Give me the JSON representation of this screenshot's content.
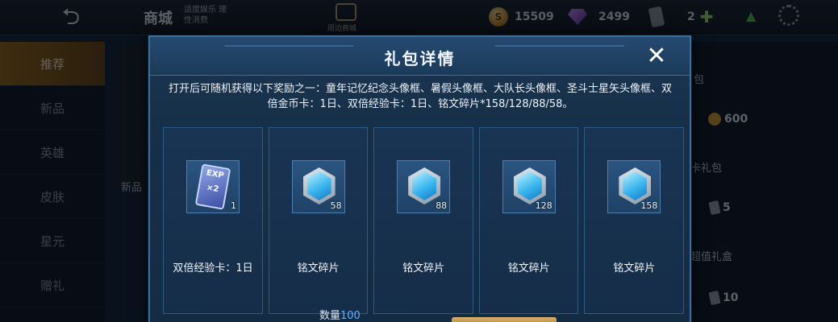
{
  "topbar": {
    "back_icon": "back-arrow-icon",
    "shop_title": "商城",
    "shop_note": "适度娱乐 理性消费",
    "mall_label": "周边商城",
    "gold": "15509",
    "diamond": "2499",
    "cards": "2"
  },
  "sidebar": {
    "items": [
      {
        "label": "推荐",
        "active": true
      },
      {
        "label": "新品"
      },
      {
        "label": "英雄"
      },
      {
        "label": "皮肤"
      },
      {
        "label": "星元"
      },
      {
        "label": "赠礼"
      }
    ]
  },
  "background": {
    "bg_text_1": "包",
    "price_1": "600",
    "bg_text_2": "卡礼包",
    "price_2": "5",
    "bg_text_3": "超值礼盒",
    "price_3": "10",
    "left_fragment": "新品"
  },
  "modal": {
    "title": "礼包详情",
    "close_label": "✕",
    "description": "打开后可随机获得以下奖励之一：童年记忆纪念头像框、暑假头像框、大队长头像框、圣斗士星矢头像框、双倍金币卡：1日、双倍经验卡：1日、铭文碎片*158/128/88/58。",
    "items": [
      {
        "name": "双倍经验卡：1日",
        "qty": "1",
        "icon": "exp-card-icon"
      },
      {
        "name": "铭文碎片",
        "qty": "58",
        "icon": "inscription-fragment-icon"
      },
      {
        "name": "铭文碎片",
        "qty": "88",
        "icon": "inscription-fragment-icon"
      },
      {
        "name": "铭文碎片",
        "qty": "128",
        "icon": "inscription-fragment-icon"
      },
      {
        "name": "铭文碎片",
        "qty": "158",
        "icon": "inscription-fragment-icon"
      }
    ],
    "amount_label": "数量",
    "amount_value": "100",
    "exp_card_top": "EXP",
    "exp_card_bottom": "×2"
  }
}
